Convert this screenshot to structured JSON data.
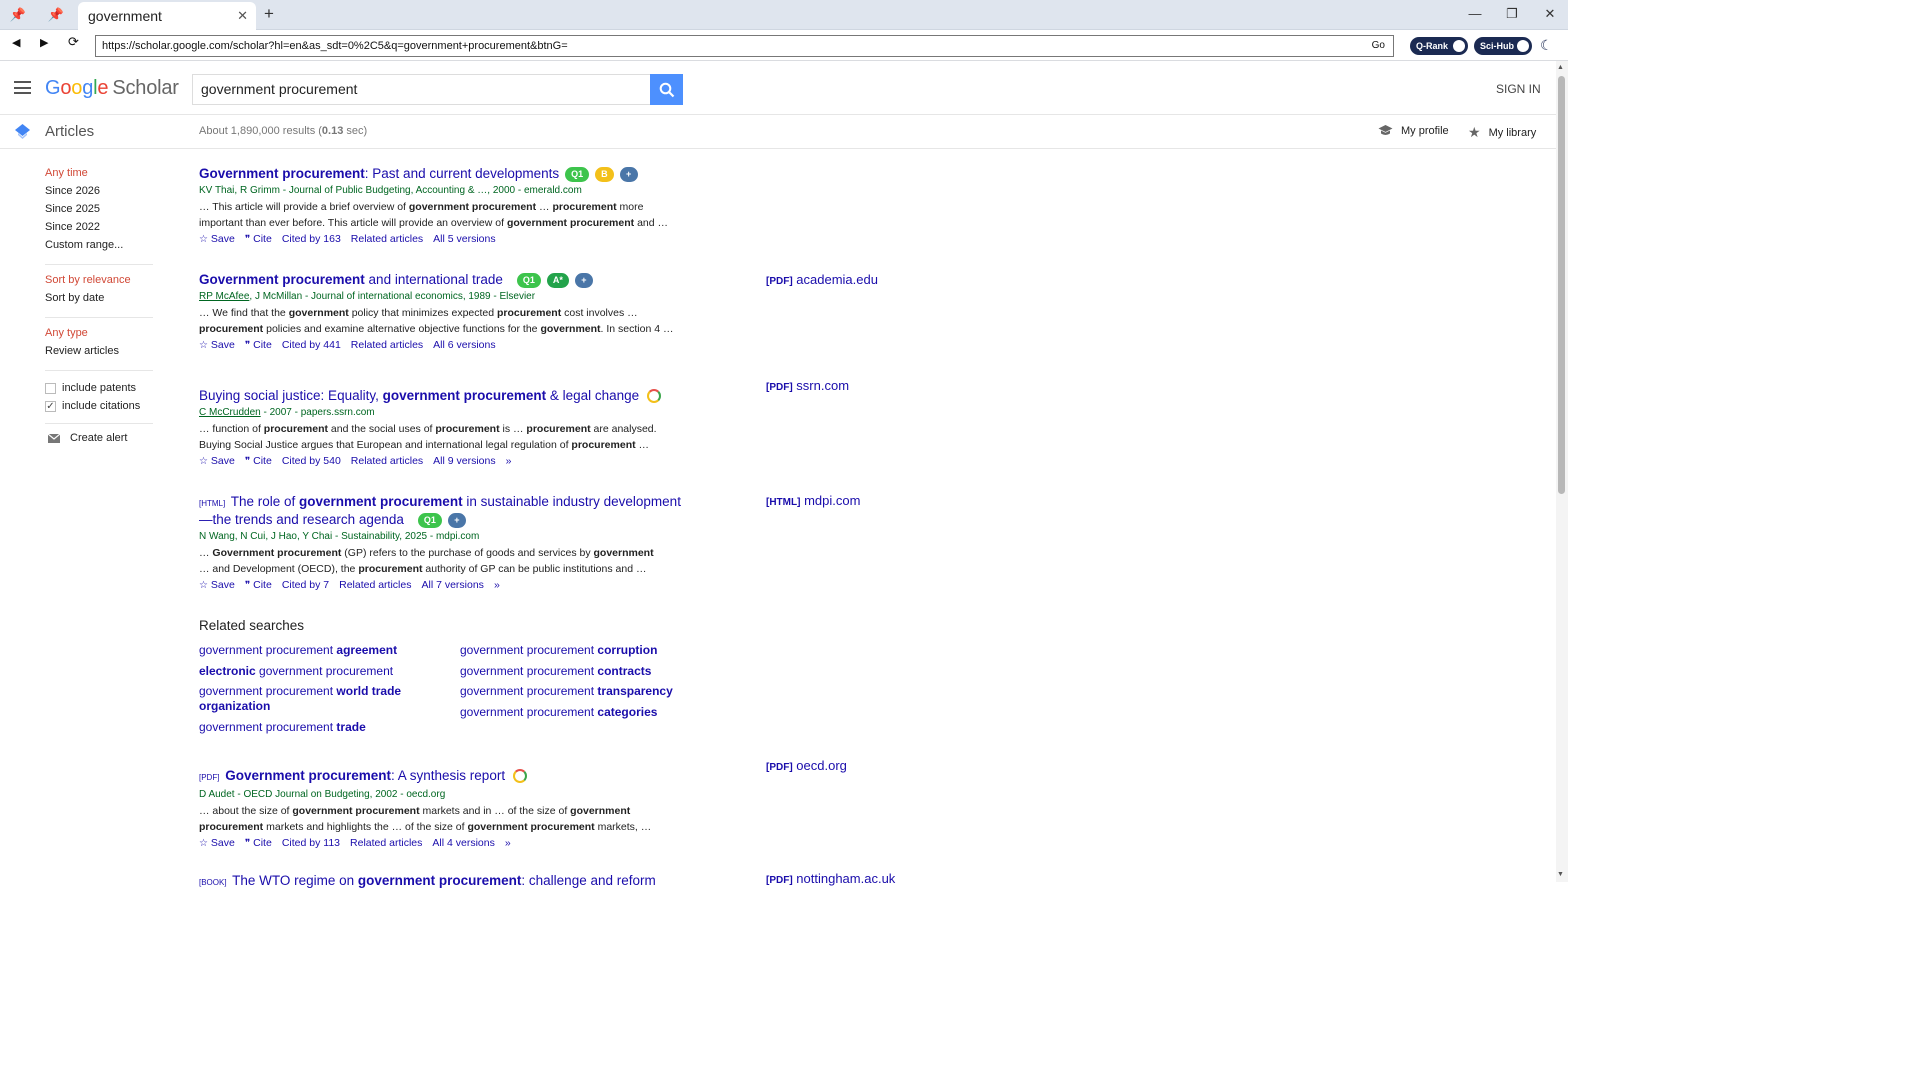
{
  "browser": {
    "tab_title": "government",
    "url": "https://scholar.google.com/scholar?hl=en&as_sdt=0%2C5&q=government+procurement&btnG=",
    "go_label": "Go",
    "ext_qrank": "Q-Rank",
    "ext_scihub": "Sci-Hub"
  },
  "header": {
    "logo_g": "G",
    "logo_o1": "o",
    "logo_o2": "o",
    "logo_g2": "g",
    "logo_l": "l",
    "logo_e": "e",
    "logo_scholar": "Scholar",
    "query": "government procurement",
    "signin": "SIGN IN"
  },
  "subheader": {
    "articles": "Articles",
    "stats_prefix": "About 1,890,000 results (",
    "stats_time": "0.13",
    "stats_suffix": " sec)",
    "my_profile": "My profile",
    "my_library": "My library"
  },
  "sidebar": {
    "time": [
      "Any time",
      "Since 2026",
      "Since 2025",
      "Since 2022",
      "Custom range..."
    ],
    "sort": [
      "Sort by relevance",
      "Sort by date"
    ],
    "type": [
      "Any type",
      "Review articles"
    ],
    "include_patents": "include patents",
    "include_citations": "include citations",
    "create_alert": "Create alert"
  },
  "results": [
    {
      "title_bold": "Government procurement",
      "title_rest": ": Past and current developments",
      "badges": [
        "Q1",
        "B",
        "+"
      ],
      "authors": "KV Thai, R Grimm - Journal of Public Budgeting, Accounting & …, 2000 - emerald.com",
      "snip1_a": "… This article will provide a brief overview of ",
      "snip1_b": "government procurement",
      "snip1_c": " … ",
      "snip1_d": "procurement",
      "snip1_e": " more",
      "snip2_a": "important than ever before. This article will provide an overview of ",
      "snip2_b": "government procurement",
      "snip2_c": " and …",
      "cited": "Cited by 163",
      "versions": "All 5 versions"
    },
    {
      "title_bold": "Government procurement",
      "title_rest": " and international trade",
      "badges": [
        "Q1",
        "A*",
        "+"
      ],
      "authors_link": "RP McAfee",
      "authors_rest": ", J McMillan - Journal of international economics, 1989 - Elsevier",
      "side_tag": "[PDF]",
      "side_site": "academia.edu",
      "snip1_a": "… We find that the ",
      "snip1_b": "government",
      "snip1_c": " policy that minimizes expected ",
      "snip1_d": "procurement",
      "snip1_e": " cost involves …",
      "snip2_b": "procurement",
      "snip2_c": " policies and examine alternative objective functions for the ",
      "snip2_d": "government",
      "snip2_e": ". In section 4 …",
      "cited": "Cited by 441",
      "versions": "All 6 versions"
    },
    {
      "title_a": "Buying social justice: Equality, ",
      "title_bold": "government procurement",
      "title_rest": " & legal change",
      "authors_link": "C McCrudden",
      "authors_rest": " - 2007 - papers.ssrn.com",
      "side_tag": "[PDF]",
      "side_site": "ssrn.com",
      "snip1_a": "… function of ",
      "snip1_b": "procurement",
      "snip1_c": " and the social uses of ",
      "snip1_d": "procurement",
      "snip1_e": " is … ",
      "snip1_f": "procurement",
      "snip1_g": " are analysed.",
      "snip2_a": "Buying Social Justice argues that European and international legal regulation of ",
      "snip2_b": "procurement",
      "snip2_c": " …",
      "cited": "Cited by 540",
      "versions": "All 9 versions"
    },
    {
      "tag": "[HTML]",
      "title_a": " The role of ",
      "title_bold": "government procurement",
      "title_rest": " in sustainable industry development",
      "title_line2": "—the trends and research agenda",
      "badges": [
        "Q1",
        "+"
      ],
      "authors": "N Wang, N Cui, J Hao, Y Chai - Sustainability, 2025 - mdpi.com",
      "side_tag": "[HTML]",
      "side_site": "mdpi.com",
      "snip1_a": "… ",
      "snip1_b": "Government procurement",
      "snip1_c": " (GP) refers to the purchase of goods and services by ",
      "snip1_d": "government",
      "snip2_a": "… and Development (OECD), the ",
      "snip2_b": "procurement",
      "snip2_c": " authority of GP can be public institutions and …",
      "cited": "Cited by 7",
      "versions": "All 7 versions"
    },
    {
      "tag": "[PDF]",
      "title_bold": "Government procurement",
      "title_rest": ": A synthesis report",
      "authors": "D Audet - OECD Journal on Budgeting, 2002 - oecd.org",
      "side_tag": "[PDF]",
      "side_site": "oecd.org",
      "snip1_a": "… about the size of ",
      "snip1_b": "government procurement",
      "snip1_c": " markets and in … of the size of ",
      "snip1_d": "government",
      "snip2_b": "procurement",
      "snip2_c": " markets and highlights the … of the size of ",
      "snip2_d": "government procurement",
      "snip2_e": " markets, …",
      "cited": "Cited by 113",
      "versions": "All 4 versions"
    },
    {
      "tag": "[BOOK]",
      "title_a": " The WTO regime on ",
      "title_bold": "government procurement",
      "title_rest": ": challenge and reform",
      "side_tag": "[PDF]",
      "side_site": "nottingham.ac.uk"
    }
  ],
  "common": {
    "save": "Save",
    "cite": "Cite",
    "related": "Related articles"
  },
  "related_searches": {
    "title": "Related searches",
    "left": [
      {
        "a": "government procurement ",
        "b": "agreement"
      },
      {
        "b": "electronic",
        "a2": " government procurement"
      },
      {
        "a": "government procurement ",
        "b": "world trade organization"
      },
      {
        "a": "government procurement ",
        "b": "trade"
      }
    ],
    "right": [
      {
        "a": "government procurement ",
        "b": "corruption"
      },
      {
        "a": "government procurement ",
        "b": "contracts"
      },
      {
        "a": "government procurement ",
        "b": "transparency"
      },
      {
        "a": "government procurement ",
        "b": "categories"
      }
    ]
  },
  "colors": {
    "link": "#1a0dab",
    "green": "#006621",
    "accent": "#4d90fe",
    "selected": "#d14836"
  }
}
